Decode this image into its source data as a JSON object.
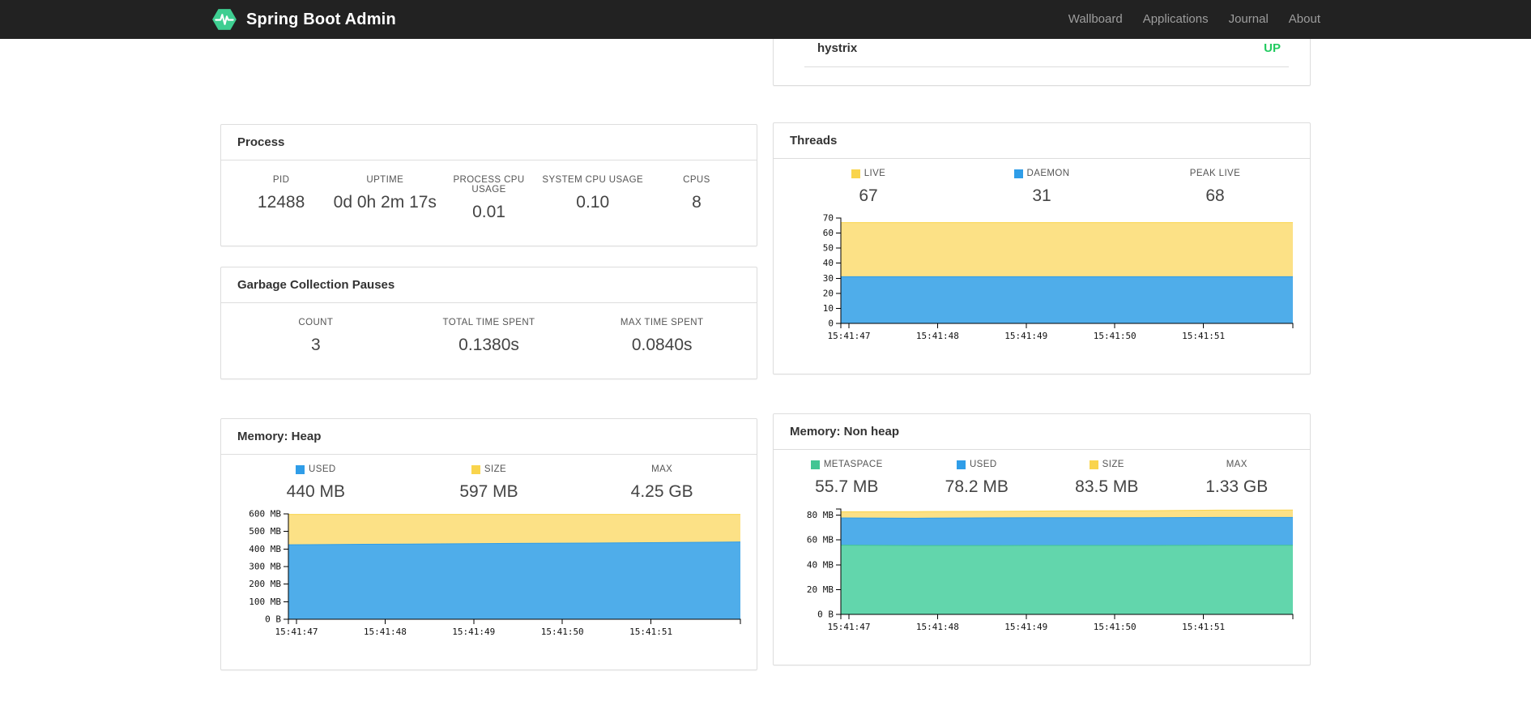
{
  "navbar": {
    "brand": "Spring Boot Admin",
    "items": [
      {
        "label": "Wallboard"
      },
      {
        "label": "Applications"
      },
      {
        "label": "Journal"
      },
      {
        "label": "About"
      }
    ]
  },
  "application_panel": {
    "name": "hystrix",
    "status": "UP"
  },
  "panels": {
    "process": {
      "title": "Process",
      "stats": [
        {
          "label": "PID",
          "value": "12488"
        },
        {
          "label": "UPTIME",
          "value": "0d 0h 2m 17s"
        },
        {
          "label": "PROCESS CPU USAGE",
          "value": "0.01"
        },
        {
          "label": "SYSTEM CPU USAGE",
          "value": "0.10"
        },
        {
          "label": "CPUS",
          "value": "8"
        }
      ]
    },
    "gc": {
      "title": "Garbage Collection Pauses",
      "stats": [
        {
          "label": "COUNT",
          "value": "3"
        },
        {
          "label": "TOTAL TIME SPENT",
          "value": "0.1380s"
        },
        {
          "label": "MAX TIME SPENT",
          "value": "0.0840s"
        }
      ]
    },
    "threads": {
      "title": "Threads",
      "stats": [
        {
          "label": "LIVE",
          "value": "67",
          "color": "#F9D44C"
        },
        {
          "label": "DAEMON",
          "value": "31",
          "color": "#2F9DE8"
        },
        {
          "label": "PEAK LIVE",
          "value": "68"
        }
      ]
    },
    "heap": {
      "title": "Memory: Heap",
      "stats": [
        {
          "label": "USED",
          "value": "440 MB",
          "color": "#2F9DE8"
        },
        {
          "label": "SIZE",
          "value": "597 MB",
          "color": "#F9D44C"
        },
        {
          "label": "MAX",
          "value": "4.25 GB"
        }
      ]
    },
    "nonheap": {
      "title": "Memory: Non heap",
      "stats": [
        {
          "label": "METASPACE",
          "value": "55.7 MB",
          "color": "#43C593"
        },
        {
          "label": "USED",
          "value": "78.2 MB",
          "color": "#2F9DE8"
        },
        {
          "label": "SIZE",
          "value": "83.5 MB",
          "color": "#F9D44C"
        },
        {
          "label": "MAX",
          "value": "1.33 GB"
        }
      ]
    }
  },
  "chart_data": [
    {
      "id": "threads",
      "type": "area",
      "title": "Threads",
      "mode": "overlay",
      "ylim": [
        0,
        70
      ],
      "y_ticks": [
        {
          "value": 0,
          "label": "0"
        },
        {
          "value": 10,
          "label": "10"
        },
        {
          "value": 20,
          "label": "20"
        },
        {
          "value": 30,
          "label": "30"
        },
        {
          "value": 40,
          "label": "40"
        },
        {
          "value": 50,
          "label": "50"
        },
        {
          "value": 60,
          "label": "60"
        },
        {
          "value": 70,
          "label": "70"
        }
      ],
      "x_ticks": [
        "15:41:47",
        "15:41:48",
        "15:41:49",
        "15:41:50",
        "15:41:51"
      ],
      "series": [
        {
          "name": "LIVE",
          "color": "#F9D44C",
          "fill": "#FCE186",
          "values": [
            67,
            67,
            67,
            67,
            67,
            67,
            67
          ]
        },
        {
          "name": "DAEMON",
          "color": "#2F9DE8",
          "fill": "#4FADEA",
          "values": [
            31,
            31,
            31,
            31,
            31,
            31,
            31
          ]
        }
      ]
    },
    {
      "id": "heap",
      "type": "area",
      "title": "Memory: Heap",
      "mode": "overlay",
      "ylim": [
        0,
        600
      ],
      "y_ticks": [
        {
          "value": 0,
          "label": "0 B"
        },
        {
          "value": 100,
          "label": "100 MB"
        },
        {
          "value": 200,
          "label": "200 MB"
        },
        {
          "value": 300,
          "label": "300 MB"
        },
        {
          "value": 400,
          "label": "400 MB"
        },
        {
          "value": 500,
          "label": "500 MB"
        },
        {
          "value": 600,
          "label": "600 MB"
        }
      ],
      "x_ticks": [
        "15:41:47",
        "15:41:48",
        "15:41:49",
        "15:41:50",
        "15:41:51"
      ],
      "series": [
        {
          "name": "SIZE",
          "color": "#F9D44C",
          "fill": "#FCE186",
          "values": [
            597,
            597,
            597,
            597,
            597,
            597,
            597
          ]
        },
        {
          "name": "USED",
          "color": "#2F9DE8",
          "fill": "#4FADEA",
          "values": [
            424,
            427,
            429,
            432,
            434,
            437,
            440
          ]
        }
      ]
    },
    {
      "id": "nonheap",
      "type": "area",
      "title": "Memory: Non heap",
      "mode": "overlay",
      "ylim": [
        0,
        85
      ],
      "y_ticks": [
        {
          "value": 0,
          "label": "0 B"
        },
        {
          "value": 20,
          "label": "20 MB"
        },
        {
          "value": 40,
          "label": "40 MB"
        },
        {
          "value": 60,
          "label": "60 MB"
        },
        {
          "value": 80,
          "label": "80 MB"
        }
      ],
      "x_ticks": [
        "15:41:47",
        "15:41:48",
        "15:41:49",
        "15:41:50",
        "15:41:51"
      ],
      "series": [
        {
          "name": "SIZE",
          "color": "#F9D44C",
          "fill": "#FCE186",
          "values": [
            82.8,
            82.9,
            83.1,
            83.5,
            83.6,
            84.1,
            84.2
          ]
        },
        {
          "name": "USED",
          "color": "#2F9DE8",
          "fill": "#4FADEA",
          "values": [
            77.8,
            77.6,
            77.9,
            78.0,
            78.0,
            78.2,
            78.2
          ]
        },
        {
          "name": "METASPACE",
          "color": "#43C593",
          "fill": "#62D6AC",
          "values": [
            55.8,
            55.5,
            55.5,
            55.6,
            55.6,
            55.7,
            55.7
          ]
        }
      ]
    }
  ],
  "colors": {
    "navbar_bg": "#222222",
    "brand_icon_green": "#3ECE91",
    "status_up": "#23CB61",
    "panel_border": "#DDDDDD"
  }
}
